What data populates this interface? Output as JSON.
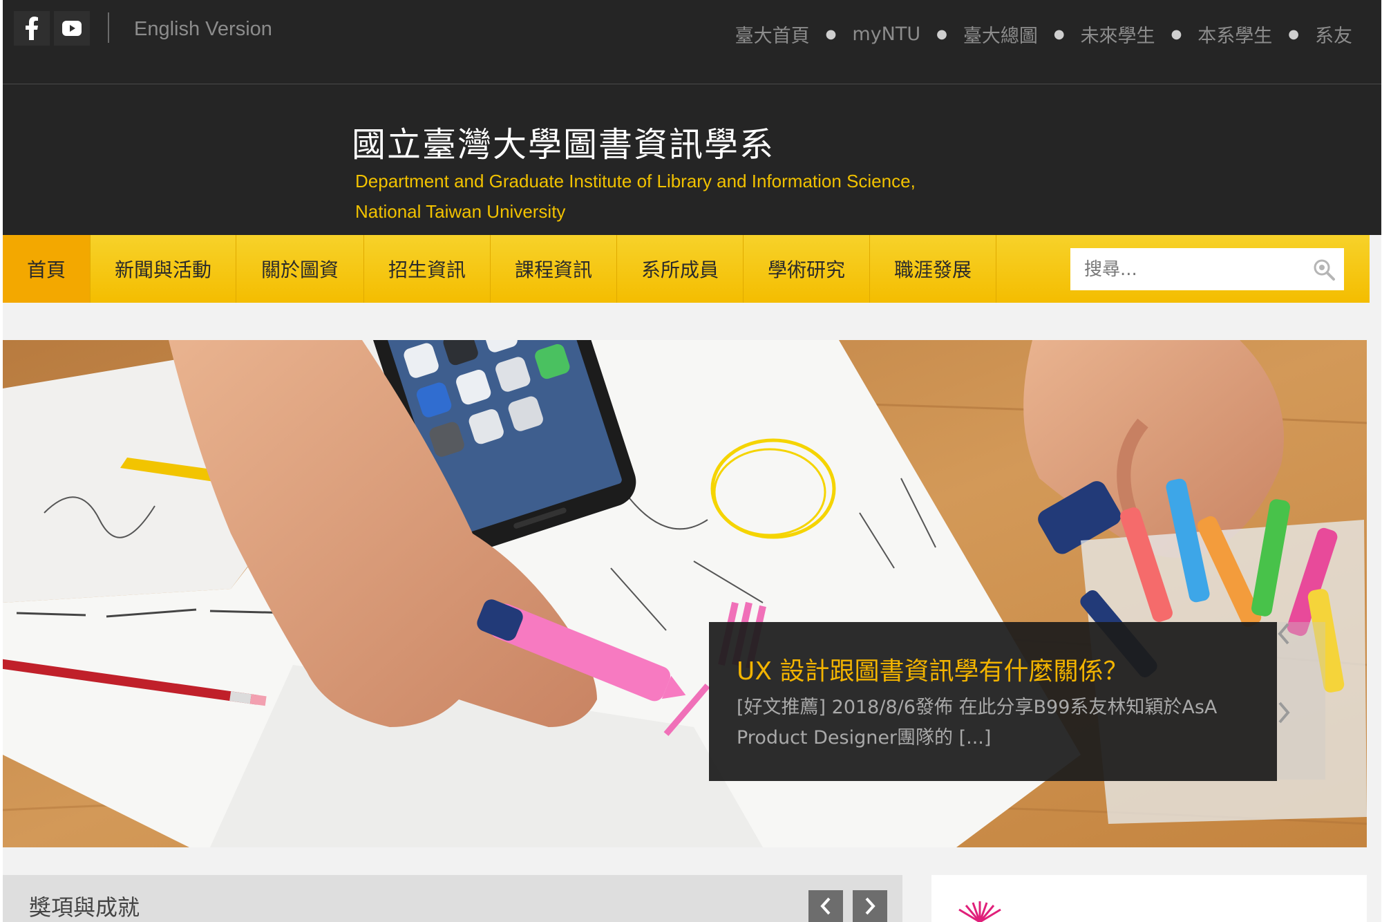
{
  "topbar": {
    "social": [
      "facebook-icon",
      "youtube-icon"
    ],
    "english_label": "English Version",
    "links": [
      "臺大首頁",
      "myNTU",
      "臺大總圖",
      "未來學生",
      "本系學生",
      "系友"
    ]
  },
  "header": {
    "title_zh": "國立臺灣大學圖書資訊學系",
    "title_en_line1": "Department and Graduate Institute of Library and Information Science,",
    "title_en_line2": "National Taiwan University"
  },
  "nav": {
    "items": [
      "首頁",
      "新聞與活動",
      "關於圖資",
      "招生資訊",
      "課程資訊",
      "系所成員",
      "學術研究",
      "職涯發展"
    ],
    "active": "首頁",
    "search_placeholder": "搜尋..."
  },
  "hero": {
    "caption_title": "UX 設計跟圖書資訊學有什麼關係？",
    "caption_text": "[好文推薦] 2018/8/6發佈 在此分享B99系友林知穎於AsA Product Designer團隊的 [...]"
  },
  "awards": {
    "title": "獎項與成就"
  },
  "colors": {
    "brand_yellow": "#f4bd00",
    "dark_bg": "#252525",
    "caption_title": "#f3b400",
    "title_en": "#f2c200"
  }
}
